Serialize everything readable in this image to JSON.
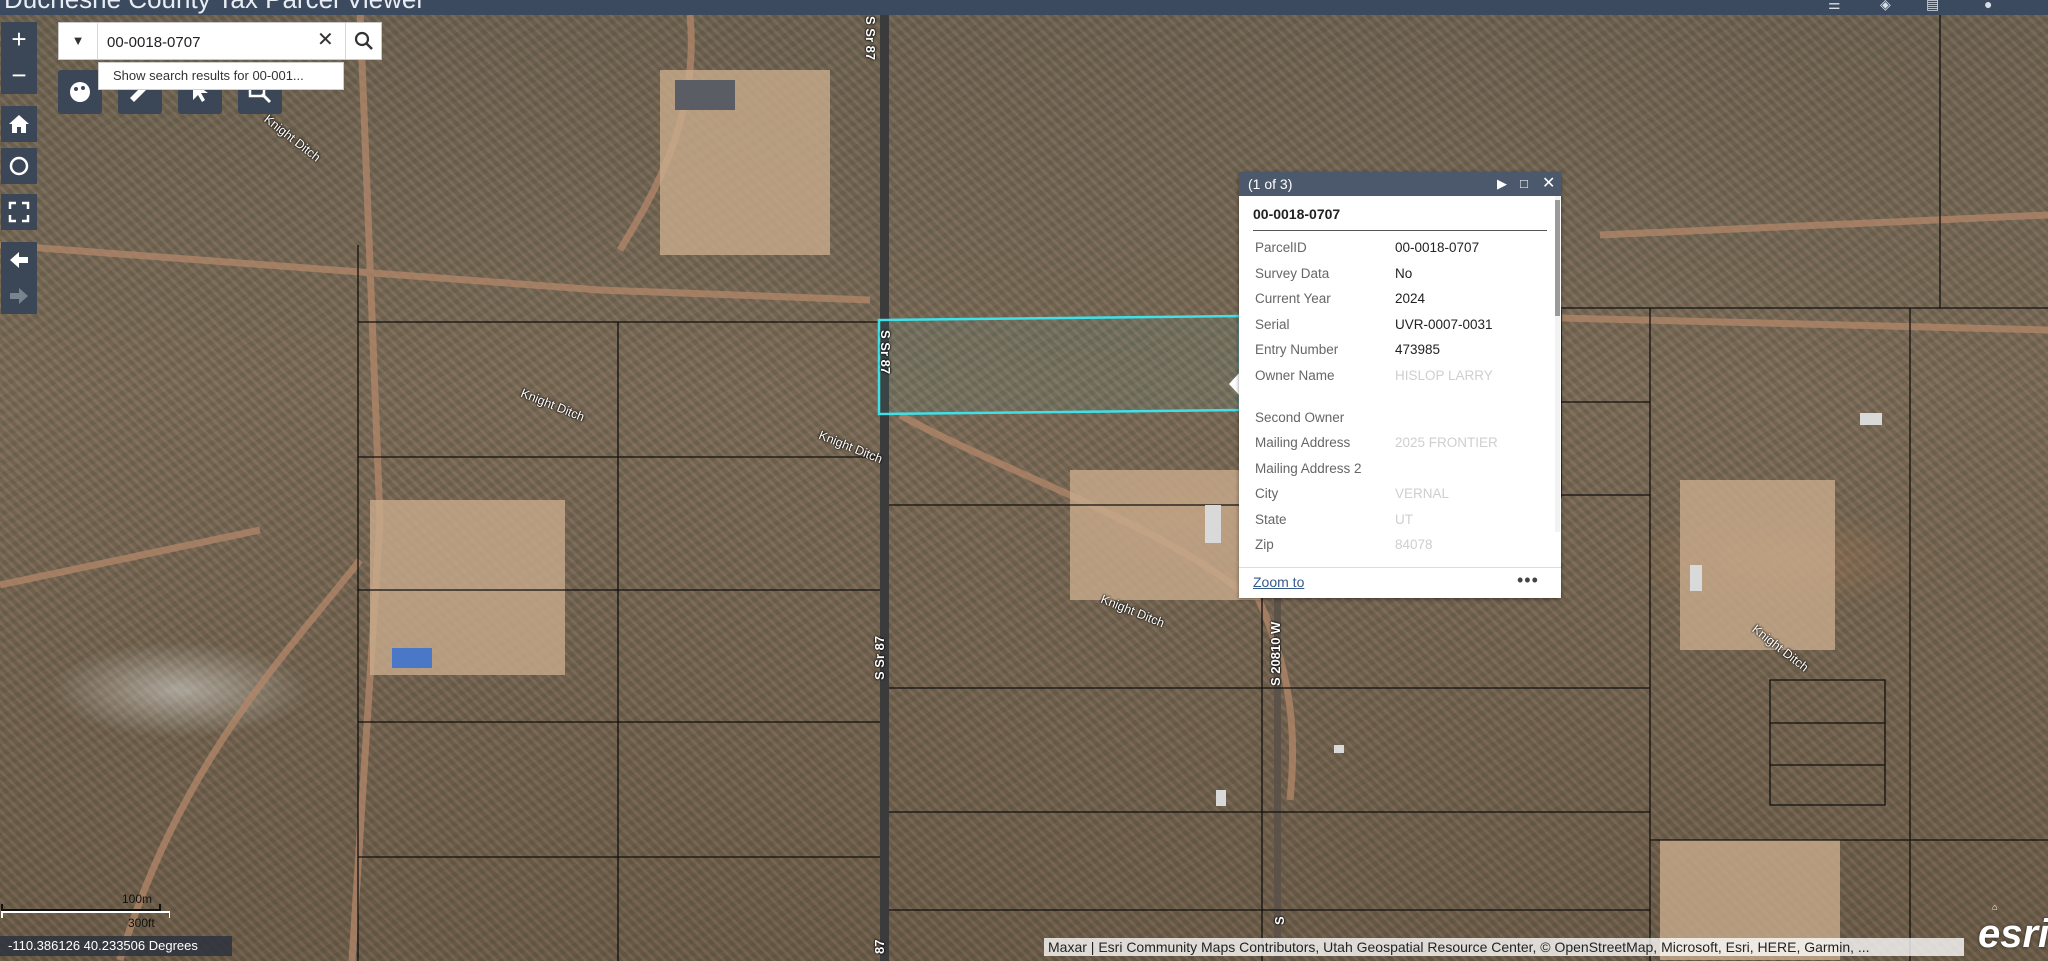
{
  "header": {
    "title": "Duchesne County Tax Parcel Viewer"
  },
  "controls": {
    "zoom_in": "+",
    "zoom_out": "−",
    "home": "home",
    "locate": "locate",
    "fullscreen": "fullscreen",
    "back": "back",
    "forward": "forward"
  },
  "search": {
    "value": "00-0018-0707",
    "suggestion": "Show search results for 00-001..."
  },
  "popup": {
    "counter": "(1 of 3)",
    "title": "00-0018-0707",
    "fields": [
      {
        "label": "ParcelID",
        "value": "00-0018-0707"
      },
      {
        "label": "Survey Data",
        "value": "No"
      },
      {
        "label": "Current Year",
        "value": "2024"
      },
      {
        "label": "Serial",
        "value": "UVR-0007-0031"
      },
      {
        "label": "Entry Number",
        "value": "473985"
      },
      {
        "label": "Owner Name",
        "value": "HISLOP LARRY"
      },
      {
        "label": "Second Owner",
        "value": ""
      },
      {
        "label": "Mailing Address",
        "value": "2025 FRONTIER"
      },
      {
        "label": "Mailing Address 2",
        "value": ""
      },
      {
        "label": "City",
        "value": "VERNAL"
      },
      {
        "label": "State",
        "value": "UT"
      },
      {
        "label": "Zip",
        "value": "84078"
      }
    ],
    "zoom_to": "Zoom to",
    "more": "•••"
  },
  "map": {
    "road_labels": [
      "S Sr 87",
      "S Sr 87",
      "S Sr 87",
      "S 20810 W",
      "S",
      "87"
    ],
    "ditch_labels": [
      "Knight Ditch",
      "Knight Ditch",
      "Knight Ditch",
      "Knight Ditch",
      "Knight Ditch"
    ],
    "parcel_highlight_color": "#3fe0e8"
  },
  "footer": {
    "coordinates": "-110.386126 40.233506 Degrees",
    "scale_metric": "100m",
    "scale_imperial": "300ft",
    "attribution": "Maxar | Esri Community Maps Contributors, Utah Geospatial Resource Center, © OpenStreetMap, Microsoft, Esri, HERE, Garmin, ...",
    "logo": "esri"
  }
}
